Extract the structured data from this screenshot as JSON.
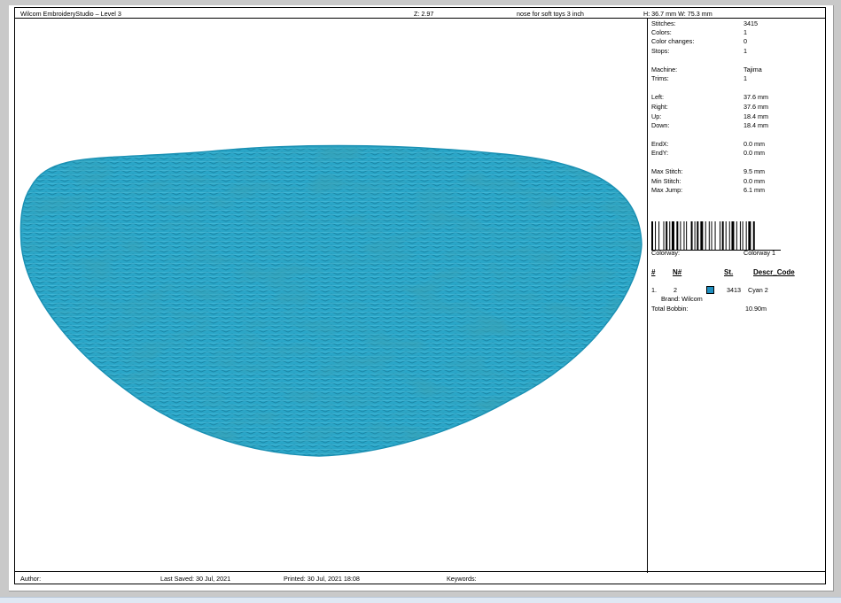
{
  "header": {
    "app_title": "Wilcom EmbroideryStudio – Level 3",
    "zoom": "Z: 2.97",
    "design_name": "nose for soft toys 3 inch",
    "dimensions": "H: 36.7 mm   W: 75.3 mm"
  },
  "stats": [
    {
      "label": "Stitches:",
      "value": "3415"
    },
    {
      "label": "Colors:",
      "value": "1"
    },
    {
      "label": "Color changes:",
      "value": "0"
    },
    {
      "label": "Stops:",
      "value": "1"
    },
    {
      "label": "Machine:",
      "value": "Tajima"
    },
    {
      "label": "Trims:",
      "value": "1"
    },
    {
      "label": "Left:",
      "value": "37.6 mm"
    },
    {
      "label": "Right:",
      "value": "37.6 mm"
    },
    {
      "label": "Up:",
      "value": "18.4 mm"
    },
    {
      "label": "Down:",
      "value": "18.4 mm"
    },
    {
      "label": "EndX:",
      "value": "0.0 mm"
    },
    {
      "label": "EndY:",
      "value": "0.0 mm"
    },
    {
      "label": "Max Stitch:",
      "value": "9.5 mm"
    },
    {
      "label": "Min Stitch:",
      "value": "0.0 mm"
    },
    {
      "label": "Max Jump:",
      "value": "6.1 mm"
    }
  ],
  "colorway": {
    "label": "Colorway:",
    "value": "Colorway 1"
  },
  "table": {
    "headers": {
      "index": "#",
      "needle": "N#",
      "stitches": "St.",
      "descr": "Descr_Code"
    },
    "row": {
      "index": "1.",
      "needle": "2",
      "stitches": "3413",
      "descr": "Cyan 2",
      "brand": "Brand: Wilcom"
    }
  },
  "total_bobbin": {
    "label": "Total Bobbin:",
    "value": "10.90m"
  },
  "footer": {
    "author": "Author:",
    "last_saved": "Last Saved: 30 Jul, 2021",
    "printed": "Printed: 30 Jul, 2021 18:08",
    "keywords": "Keywords:"
  },
  "colors": {
    "thread": "#2ba7c9",
    "thread_dark": "#137895",
    "swatch": "#1f8fc0"
  }
}
